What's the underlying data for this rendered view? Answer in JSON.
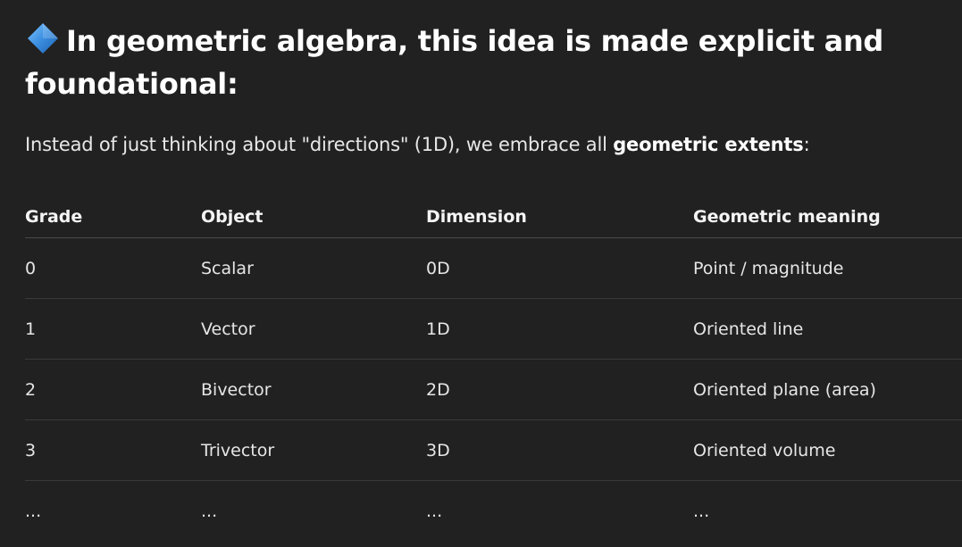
{
  "heading": {
    "icon": "small-blue-diamond-icon",
    "part1": "In ",
    "bold1": "geometric algebra",
    "part2": ", this idea is made ",
    "bold2": "explicit and foundational",
    "part3": ":"
  },
  "intro": {
    "before": "Instead of just thinking about \"directions\" (1D), we embrace all ",
    "bold": "geometric extents",
    "after": ":"
  },
  "table": {
    "columns": [
      "Grade",
      "Object",
      "Dimension",
      "Geometric meaning"
    ],
    "rows": [
      [
        "0",
        "Scalar",
        "0D",
        "Point / magnitude"
      ],
      [
        "1",
        "Vector",
        "1D",
        "Oriented line"
      ],
      [
        "2",
        "Bivector",
        "2D",
        "Oriented plane (area)"
      ],
      [
        "3",
        "Trivector",
        "3D",
        "Oriented volume"
      ],
      [
        "...",
        "...",
        "...",
        "..."
      ]
    ]
  },
  "colors": {
    "background": "#212121",
    "text": "#ececec",
    "divider": "#3a3a3a",
    "icon_blue": "#3b8ee0"
  }
}
